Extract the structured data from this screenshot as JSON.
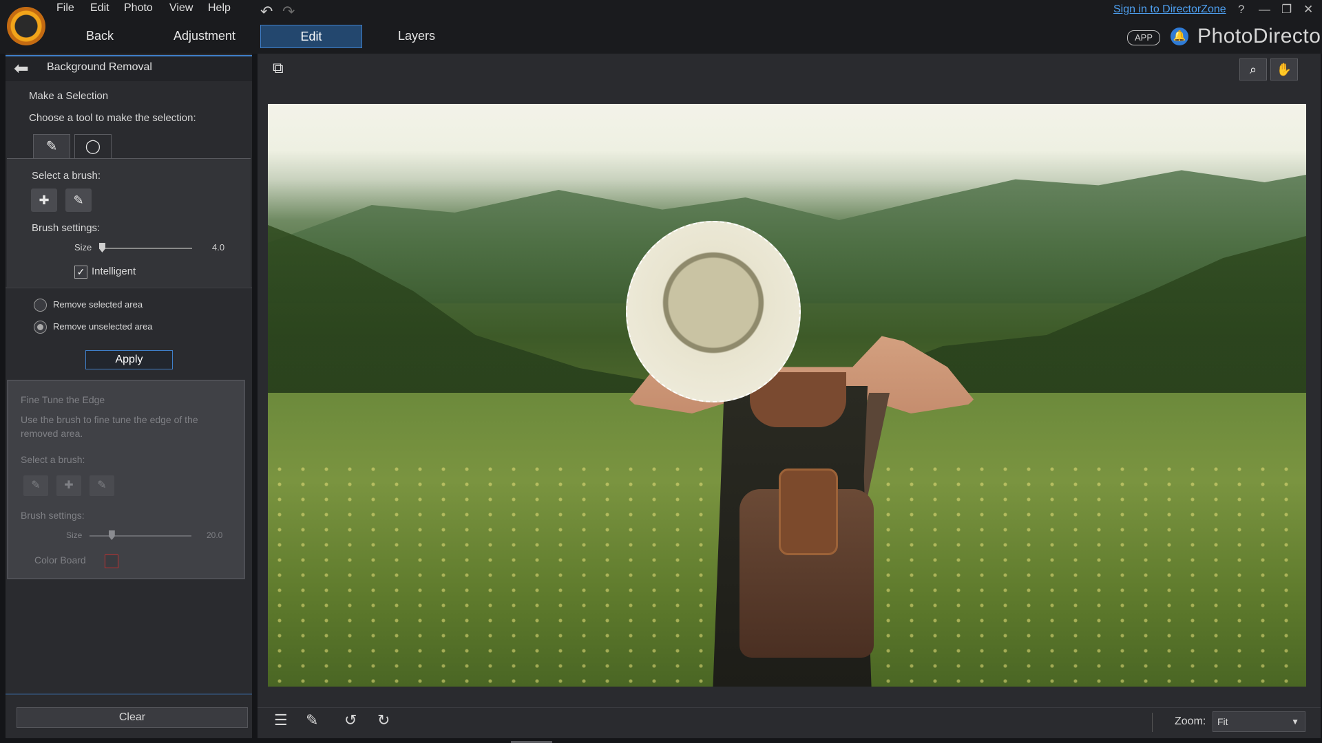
{
  "menu": {
    "items": [
      "File",
      "Edit",
      "Photo",
      "View",
      "Help"
    ]
  },
  "tabs": {
    "back": "Back",
    "adjustment": "Adjustment",
    "edit": "Edit",
    "layers": "Layers"
  },
  "header": {
    "signin": "Sign in to DirectorZone",
    "help": "?",
    "app_badge": "APP",
    "brand": "PhotoDirector"
  },
  "panel": {
    "title": "Background Removal",
    "make_selection": "Make a Selection",
    "choose_tool": "Choose a tool to make the selection:",
    "select_brush": "Select a brush:",
    "brush_settings": "Brush settings:",
    "size_label": "Size",
    "size_value": "4.0",
    "size_level": 0.0,
    "intelligent_label": "Intelligent",
    "intelligent_checked": true,
    "remove_selected": "Remove selected area",
    "remove_unselected": "Remove unselected area",
    "selected_option": "remove_unselected",
    "apply": "Apply",
    "clear": "Clear"
  },
  "fine_tune": {
    "title": "Fine Tune the Edge",
    "desc": "Use the brush to fine tune the edge of the removed area.",
    "select_brush": "Select a brush:",
    "brush_settings": "Brush settings:",
    "size_label": "Size",
    "size_value": "20.0",
    "size_level": 0.2,
    "color_board": "Color Board"
  },
  "toolbar": {
    "zoom_label": "Zoom:",
    "zoom_value": "Fit"
  },
  "colors": {
    "accent": "#3f7fc9",
    "link": "#4ea0f0",
    "panel_bg": "#2a2b2f"
  }
}
